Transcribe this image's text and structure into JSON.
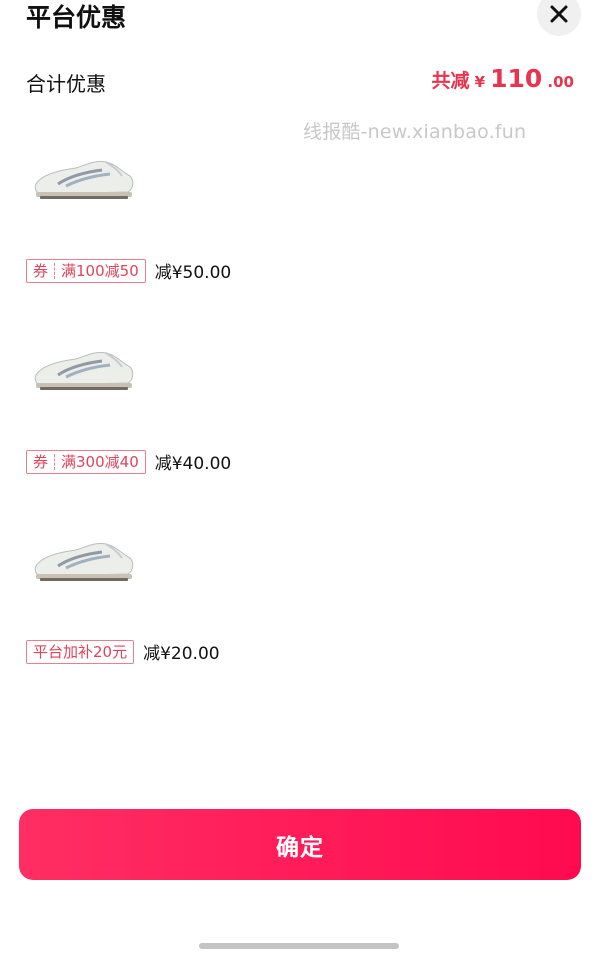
{
  "sheet": {
    "title": "平台优惠"
  },
  "summary": {
    "label": "合计优惠",
    "total_label": "共减",
    "currency": "¥",
    "amount_integer": "110",
    "amount_decimal": ".00"
  },
  "watermark": "线报酷-new.xianbao.fun",
  "items": [
    {
      "tag_prefix": "券",
      "tag_text": "满100减50",
      "amount_text": "减¥50.00"
    },
    {
      "tag_prefix": "券",
      "tag_text": "满300减40",
      "amount_text": "减¥40.00"
    },
    {
      "tag_prefix": "",
      "tag_text": "平台加补20元",
      "amount_text": "减¥20.00"
    }
  ],
  "confirm_label": "确定",
  "colors": {
    "accent": "#e8344e",
    "button": "#ff1a57",
    "tag_border": "#e8818f"
  },
  "icons": {
    "close": "close-icon",
    "product": "sneaker-image"
  }
}
